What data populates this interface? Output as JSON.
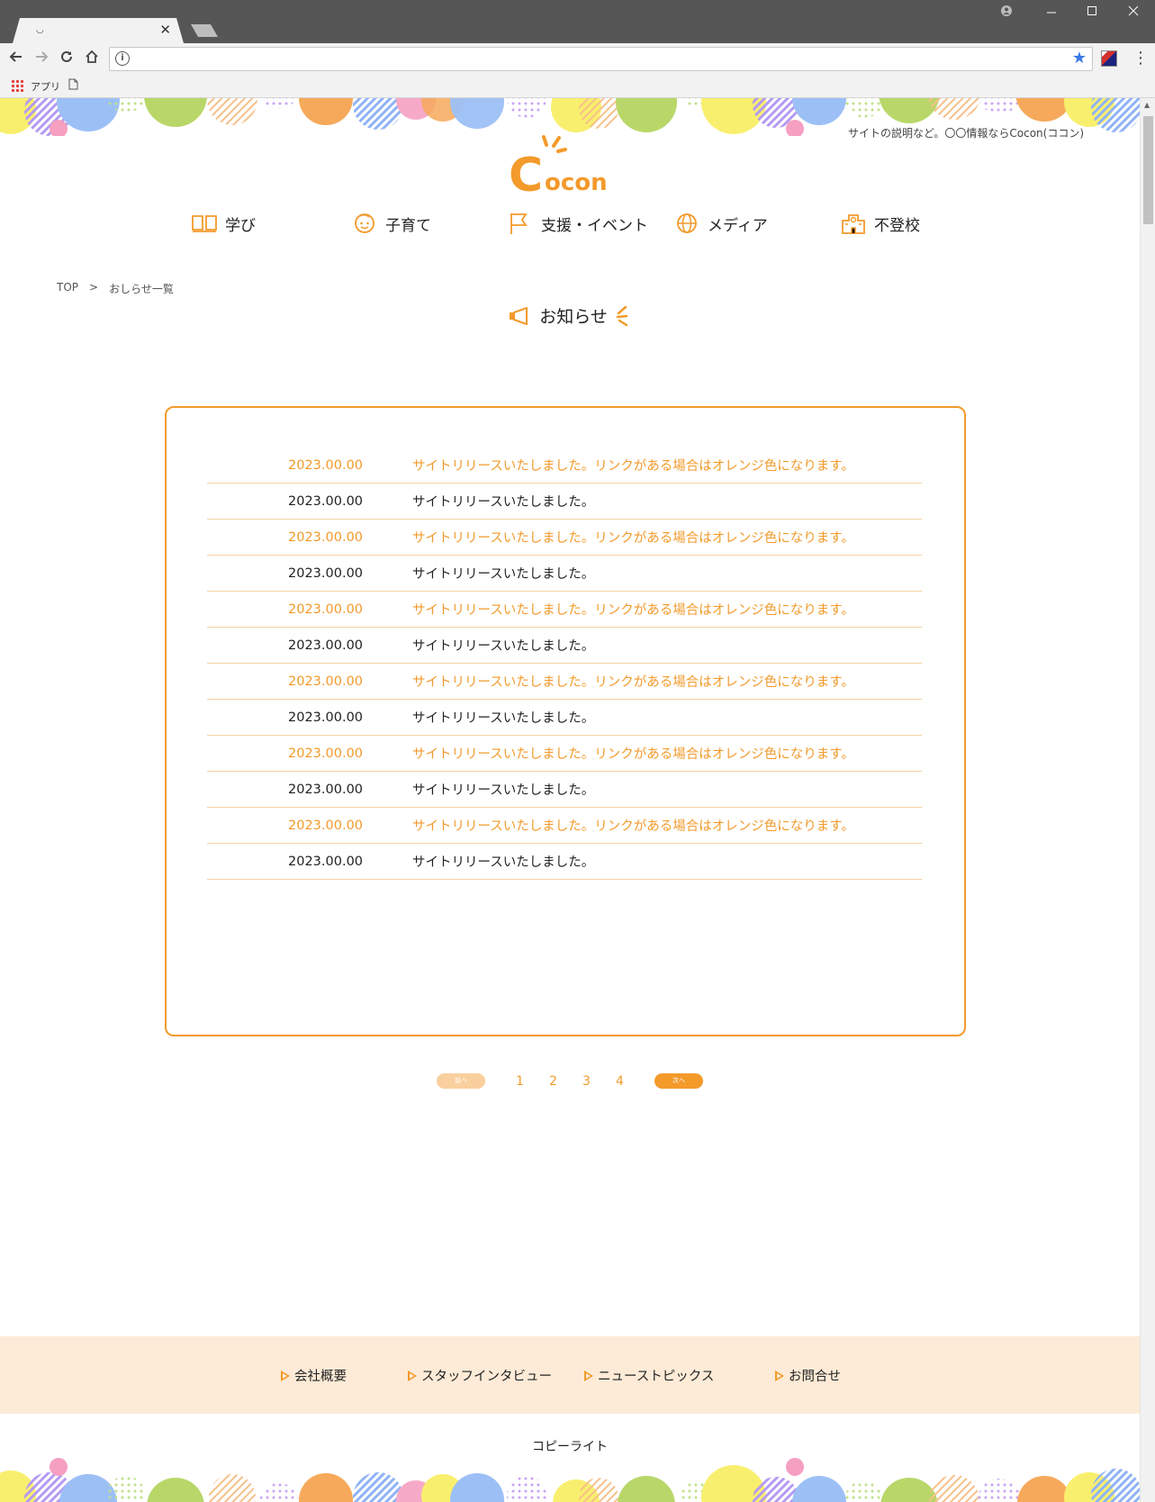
{
  "browser": {
    "tab_favicon": "◡",
    "tab_close": "✕",
    "bookmark_apps": "アプリ"
  },
  "header": {
    "tagline": "サイトの説明など。〇〇情報ならCocon(ココン)",
    "logo_text": "Cocon"
  },
  "nav": {
    "items": [
      {
        "label": "学び",
        "icon": "book-icon"
      },
      {
        "label": "子育て",
        "icon": "child-face-icon"
      },
      {
        "label": "支援・イベント",
        "icon": "flag-icon"
      },
      {
        "label": "メディア",
        "icon": "globe-icon"
      },
      {
        "label": "不登校",
        "icon": "school-icon"
      }
    ]
  },
  "breadcrumb": {
    "top": "TOP",
    "separator": ">",
    "current": "おしらせ一覧"
  },
  "page_title": "お知らせ",
  "news": [
    {
      "date": "2023.00.00",
      "text": "サイトリリースいたしました。リンクがある場合はオレンジ色になります。",
      "link": true
    },
    {
      "date": "2023.00.00",
      "text": "サイトリリースいたしました。",
      "link": false
    },
    {
      "date": "2023.00.00",
      "text": "サイトリリースいたしました。リンクがある場合はオレンジ色になります。",
      "link": true
    },
    {
      "date": "2023.00.00",
      "text": "サイトリリースいたしました。",
      "link": false
    },
    {
      "date": "2023.00.00",
      "text": "サイトリリースいたしました。リンクがある場合はオレンジ色になります。",
      "link": true
    },
    {
      "date": "2023.00.00",
      "text": "サイトリリースいたしました。",
      "link": false
    },
    {
      "date": "2023.00.00",
      "text": "サイトリリースいたしました。リンクがある場合はオレンジ色になります。",
      "link": true
    },
    {
      "date": "2023.00.00",
      "text": "サイトリリースいたしました。",
      "link": false
    },
    {
      "date": "2023.00.00",
      "text": "サイトリリースいたしました。リンクがある場合はオレンジ色になります。",
      "link": true
    },
    {
      "date": "2023.00.00",
      "text": "サイトリリースいたしました。",
      "link": false
    },
    {
      "date": "2023.00.00",
      "text": "サイトリリースいたしました。リンクがある場合はオレンジ色になります。",
      "link": true
    },
    {
      "date": "2023.00.00",
      "text": "サイトリリースいたしました。",
      "link": false
    }
  ],
  "pagination": {
    "prev": "前へ",
    "pages": [
      "1",
      "2",
      "3",
      "4"
    ],
    "next": "次へ"
  },
  "footer": {
    "links": [
      "会社概要",
      "スタッフインタビュー",
      "ニューストピックス",
      "お問合せ"
    ],
    "copyright": "コピーライト"
  },
  "colors": {
    "accent": "#f39a2b",
    "footer_band": "#fdebd7",
    "divider": "#f6d2a6"
  }
}
